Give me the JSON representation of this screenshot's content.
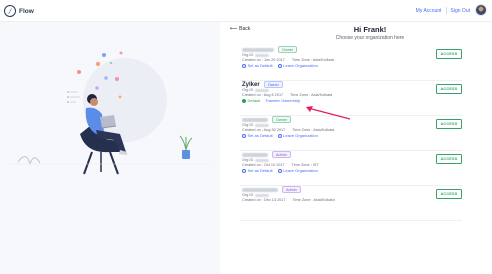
{
  "header": {
    "brand": "Flow",
    "my_account": "My Account",
    "sign_out": "Sign Out"
  },
  "page": {
    "back_label": "Back",
    "greeting": "Hi Frank!",
    "subtitle": "Choose your organization here"
  },
  "organizations": [
    {
      "name": "",
      "name_hidden": true,
      "role": "Owner",
      "role_color": "green",
      "id_label": "Org ID",
      "created": "Created on : Jun 29 2017",
      "timezone": "Time Zone : Asia/Kolkata",
      "action_primary": "Set as Default",
      "action_secondary": "Leave Organization",
      "is_default": false,
      "access_label": "ACCESS"
    },
    {
      "name": "Zylker",
      "name_hidden": false,
      "role": "Owner",
      "role_color": "blue",
      "id_label": "Org ID",
      "created": "Created on : Aug 8 2017",
      "timezone": "Time Zone : Asia/Kolkata",
      "action_primary": "Default",
      "action_secondary": "Transfer Ownership",
      "is_default": true,
      "access_label": "ACCESS"
    },
    {
      "name": "",
      "name_hidden": true,
      "role": "Owner",
      "role_color": "green",
      "id_label": "Org ID",
      "created": "Created on : Aug 30 2017",
      "timezone": "Time Zone : Asia/Kolkata",
      "action_primary": "Set as Default",
      "action_secondary": "Leave Organization",
      "is_default": false,
      "access_label": "ACCESS"
    },
    {
      "name": "",
      "name_hidden": true,
      "role": "Admin",
      "role_color": "purple",
      "id_label": "Org ID",
      "created": "Created on : Oct 10 2017",
      "timezone": "Time Zone : IST",
      "action_primary": "Set as Default",
      "action_secondary": "Leave Organization",
      "is_default": false,
      "access_label": "ACCESS"
    },
    {
      "name": "",
      "name_hidden": true,
      "role": "Admin",
      "role_color": "purple",
      "id_label": "Org ID",
      "created": "Created on : Dec 13 2017",
      "timezone": "Time Zone : Asia/Kolkata",
      "action_primary": "",
      "action_secondary": "",
      "is_default": false,
      "access_label": "ACCESS"
    }
  ],
  "colors": {
    "accent": "#4a6cf7",
    "success": "#38a169",
    "annotation_arrow": "#e0245e",
    "illustration_bg": "#f7f8fb"
  },
  "icons": [
    "logo-icon",
    "back-arrow-icon",
    "user-avatar-icon",
    "link-icon",
    "check-circle-icon"
  ]
}
